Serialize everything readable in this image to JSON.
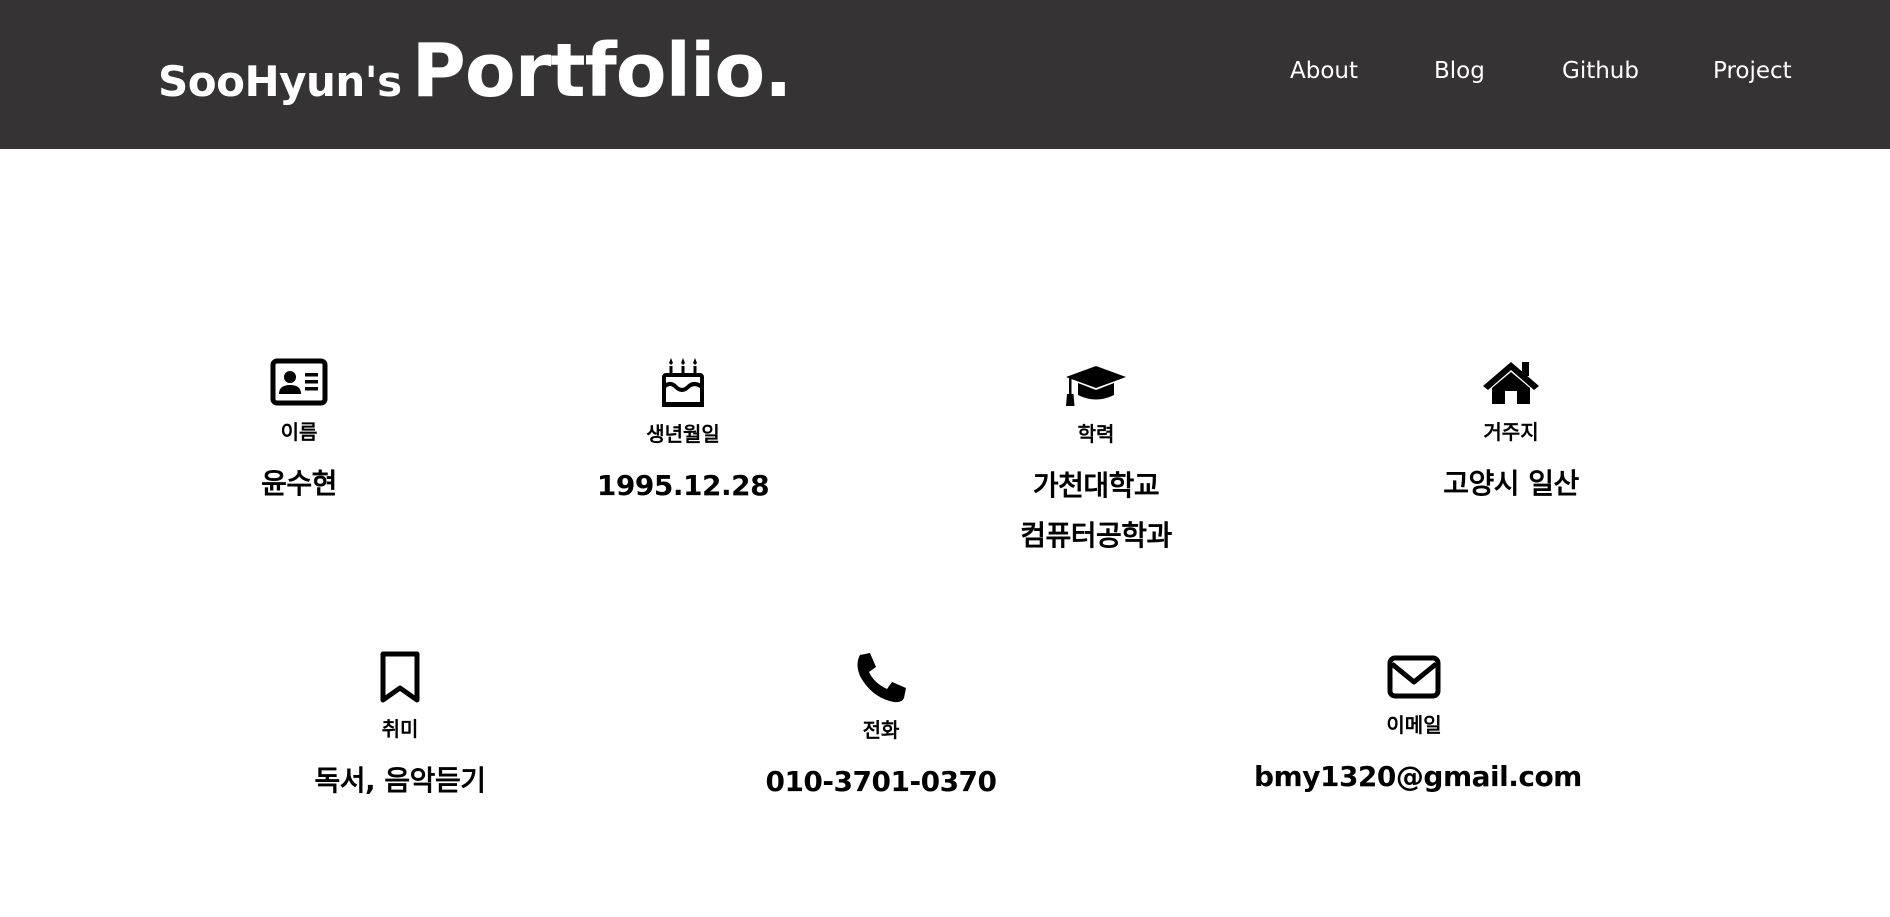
{
  "header": {
    "brand_small": "SooHyun's",
    "brand_big": "Portfolio.",
    "background": "#353334",
    "nav": [
      {
        "label": "About"
      },
      {
        "label": "Blog"
      },
      {
        "label": "Github"
      },
      {
        "label": "Project"
      }
    ]
  },
  "profile": {
    "name": {
      "icon": "id-card-icon",
      "label": "이름",
      "value": "윤수현"
    },
    "birthday": {
      "icon": "birthday-cake-icon",
      "label": "생년월일",
      "value": "1995.12.28"
    },
    "education": {
      "icon": "graduation-cap-icon",
      "label": "학력",
      "value_line1": "가천대학교",
      "value_line2": "컴퓨터공학과"
    },
    "address": {
      "icon": "home-icon",
      "label": "거주지",
      "value": "고양시 일산"
    },
    "hobby": {
      "icon": "bookmark-icon",
      "label": "취미",
      "value": "독서, 음악듣기"
    },
    "phone": {
      "icon": "phone-icon",
      "label": "전화",
      "value": "010-3701-0370"
    },
    "email": {
      "icon": "envelope-icon",
      "label": "이메일",
      "value": "bmy1320@gmail.com"
    }
  }
}
